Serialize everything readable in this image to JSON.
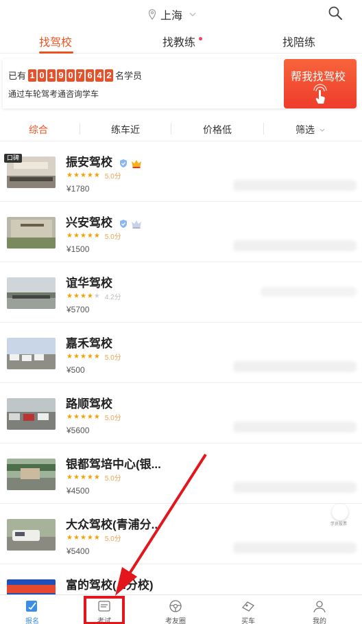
{
  "topbar": {
    "city": "上海"
  },
  "main_tabs": [
    {
      "label": "找驾校",
      "active": true
    },
    {
      "label": "找教练",
      "active": false,
      "dot": true
    },
    {
      "label": "找陪练",
      "active": false
    }
  ],
  "banner": {
    "prefix": "已有",
    "count_digits": [
      "1",
      "0",
      "1",
      "9",
      "0",
      "7",
      "6",
      "4",
      "2"
    ],
    "suffix": "名学员",
    "subtitle": "通过车轮驾考通咨询学车",
    "cta_label": "帮我找驾校"
  },
  "filters": [
    {
      "label": "综合",
      "active": true
    },
    {
      "label": "练车近",
      "active": false
    },
    {
      "label": "价格低",
      "active": false
    },
    {
      "label": "筛选",
      "active": false
    }
  ],
  "schools": [
    {
      "name": "振安驾校",
      "badge": "口碑",
      "stars": 5,
      "score": "5.0分",
      "price": "¥1780",
      "verified": true,
      "crown": "gold"
    },
    {
      "name": "兴安驾校",
      "stars": 5,
      "score": "5.0分",
      "price": "¥1500",
      "verified": true,
      "crown": "silver"
    },
    {
      "name": "谊华驾校",
      "stars": 4,
      "score": "4.2分",
      "price": "¥5700"
    },
    {
      "name": "嘉禾驾校",
      "stars": 5,
      "score": "5.0分",
      "price": "¥500"
    },
    {
      "name": "路顺驾校",
      "stars": 5,
      "score": "5.0分",
      "price": "¥5600"
    },
    {
      "name": "银都驾培中心(银...",
      "stars": 5,
      "score": "5.0分",
      "price": "¥4500"
    },
    {
      "name": "大众驾校(青浦分...",
      "stars": 5,
      "score": "5.0分",
      "price": "¥5400"
    },
    {
      "name": "富的驾校(...分校)",
      "stars": 5,
      "score": "",
      "price": ""
    }
  ],
  "float_widget": {
    "label": "学员投票"
  },
  "bottom_nav": [
    {
      "label": "报名",
      "icon": "signup-icon",
      "active": true
    },
    {
      "label": "考试",
      "icon": "exam-icon",
      "active": false
    },
    {
      "label": "考友圈",
      "icon": "steering-wheel-icon",
      "active": false
    },
    {
      "label": "买车",
      "icon": "car-tag-icon",
      "active": false
    },
    {
      "label": "我的",
      "icon": "profile-icon",
      "active": false
    }
  ],
  "colors": {
    "accent": "#f0521f",
    "annotation_red": "#e3161d",
    "nav_active": "#3a8ee6"
  }
}
